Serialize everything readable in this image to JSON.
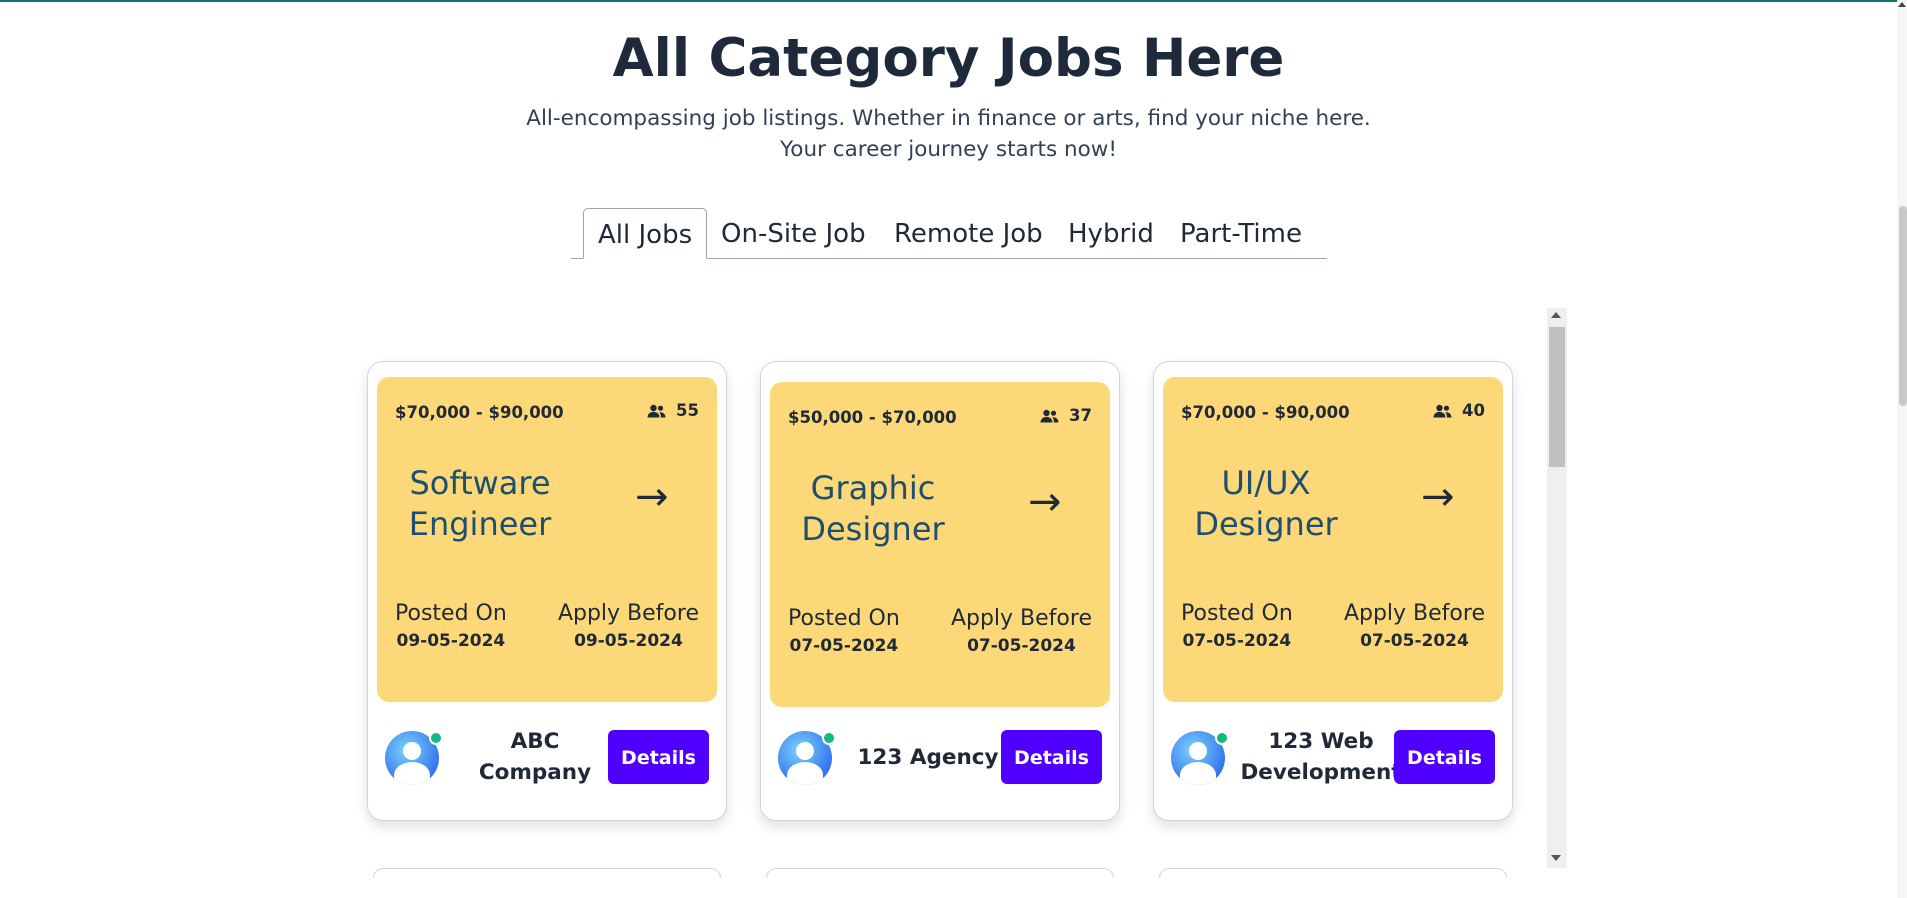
{
  "header": {
    "title": "All Category Jobs Here",
    "subtitle_line1": "All-encompassing job listings. Whether in finance or arts, find your niche here.",
    "subtitle_line2": "Your career journey starts now!"
  },
  "tabs": [
    {
      "label": "All Jobs",
      "active": true
    },
    {
      "label": "On-Site Job",
      "active": false
    },
    {
      "label": "Remote Job",
      "active": false
    },
    {
      "label": "Hybrid",
      "active": false
    },
    {
      "label": "Part-Time",
      "active": false
    }
  ],
  "jobs": [
    {
      "salary": "$70,000 - $90,000",
      "applicants": "55",
      "title_line1": "Software",
      "title_line2": "Engineer",
      "posted_label": "Posted On",
      "posted_date": "09-05-2024",
      "apply_label": "Apply Before",
      "apply_date": "09-05-2024",
      "company_line1": "ABC",
      "company_line2": "Company",
      "button_label": "Details"
    },
    {
      "salary": "$50,000 - $70,000",
      "applicants": "37",
      "title_line1": "Graphic",
      "title_line2": "Designer",
      "posted_label": "Posted On",
      "posted_date": "07-05-2024",
      "apply_label": "Apply Before",
      "apply_date": "07-05-2024",
      "company_line1": "123 Agency",
      "company_line2": "",
      "button_label": "Details"
    },
    {
      "salary": "$70,000 - $90,000",
      "applicants": "40",
      "title_line1": "UI/UX",
      "title_line2": "Designer",
      "posted_label": "Posted On",
      "posted_date": "07-05-2024",
      "apply_label": "Apply Before",
      "apply_date": "07-05-2024",
      "company_line1": "123 Web",
      "company_line2": "Development",
      "button_label": "Details"
    }
  ],
  "colors": {
    "panel": "#fdd878",
    "button": "#4f00ff",
    "title_text": "#1e4f6e",
    "online": "#10b981"
  },
  "icons": {
    "applicants": "people-icon",
    "go": "arrow-right-icon",
    "avatar": "user-avatar-icon"
  }
}
